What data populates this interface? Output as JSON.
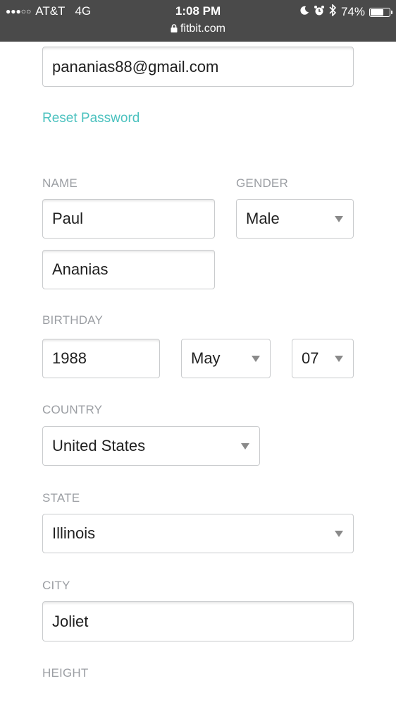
{
  "status_bar": {
    "signal": "●●●○○",
    "carrier": "AT&T",
    "network": "4G",
    "time": "1:08 PM",
    "battery": "74%",
    "battery_level": 0.74,
    "url": "fitbit.com"
  },
  "account": {
    "email_value": "pananias88@gmail.com",
    "reset_password_label": "Reset Password"
  },
  "profile": {
    "name_label": "NAME",
    "first_name_value": "Paul",
    "last_name_value": "Ananias",
    "gender_label": "GENDER",
    "gender_value": "Male",
    "birthday_label": "BIRTHDAY",
    "birth_year_value": "1988",
    "birth_month_value": "May",
    "birth_day_value": "07",
    "country_label": "COUNTRY",
    "country_value": "United States",
    "state_label": "STATE",
    "state_value": "Illinois",
    "city_label": "CITY",
    "city_value": "Joliet",
    "height_label": "HEIGHT"
  },
  "icons": {
    "lock": "lock-icon",
    "moon": "moon-icon",
    "alarm": "alarm-icon",
    "bluetooth": "bluetooth-icon",
    "battery": "battery-icon",
    "caret": "chevron-down-icon"
  }
}
